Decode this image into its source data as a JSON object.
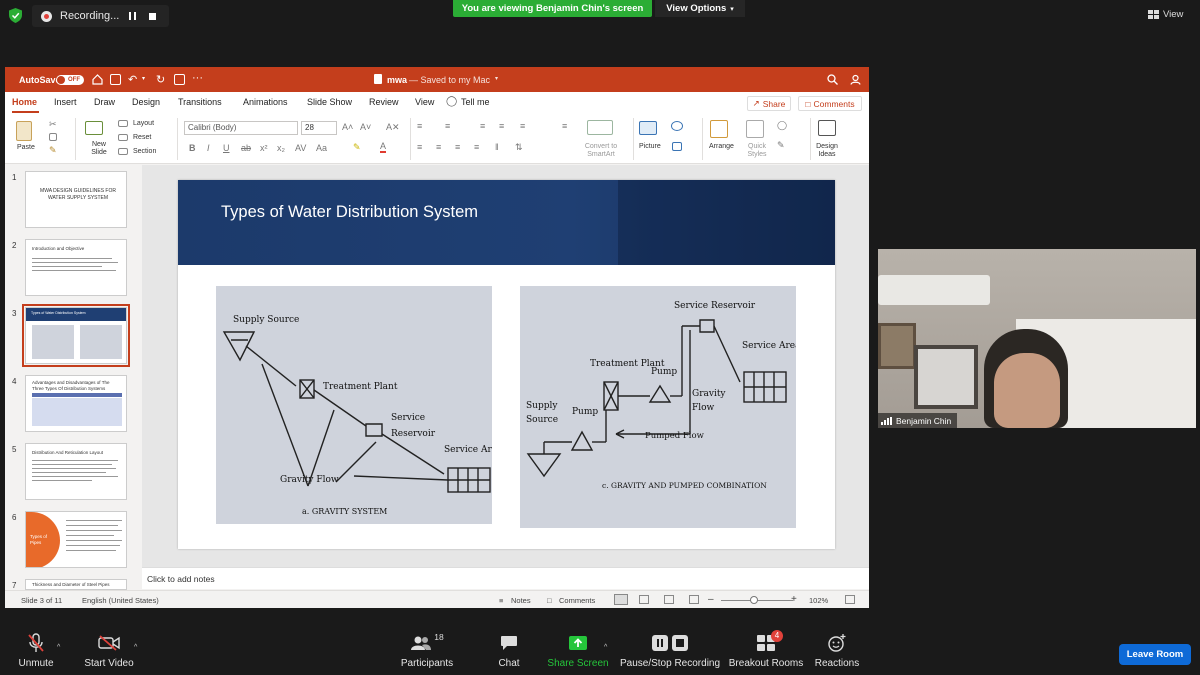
{
  "zoom": {
    "recording_label": "Recording...",
    "viewing_banner": "You are viewing Benjamin Chin's screen",
    "view_options": "View Options",
    "view_label": "View",
    "toolbar": {
      "unmute": "Unmute",
      "start_video": "Start Video",
      "participants": "Participants",
      "participants_count": "18",
      "chat": "Chat",
      "share_screen": "Share Screen",
      "pause_stop_recording": "Pause/Stop Recording",
      "breakout_rooms": "Breakout Rooms",
      "breakout_badge": "4",
      "reactions": "Reactions",
      "leave_room": "Leave Room"
    },
    "video": {
      "participant_name": "Benjamin Chin"
    }
  },
  "ppt": {
    "autosave": "AutoSave",
    "autosave_state": "OFF",
    "doc_title": "mwa",
    "doc_status": "— Saved to my Mac",
    "tabs": [
      "Home",
      "Insert",
      "Draw",
      "Design",
      "Transitions",
      "Animations",
      "Slide Show",
      "Review",
      "View"
    ],
    "tell_me": "Tell me",
    "share": "Share",
    "comments": "Comments",
    "ribbon": {
      "paste": "Paste",
      "new_slide": "New Slide",
      "layout": "Layout",
      "reset": "Reset",
      "section": "Section",
      "font": "Calibri (Body)",
      "font_size": "28",
      "convert_smartart": "Convert to SmartArt",
      "picture": "Picture",
      "arrange": "Arrange",
      "quick_styles": "Quick Styles",
      "design_ideas": "Design Ideas"
    },
    "thumbnails": [
      {
        "num": "1",
        "title": "MWA DESIGN GUIDELINES FOR WATER SUPPLY SYSTEM"
      },
      {
        "num": "2",
        "title": "Introduction and Objective"
      },
      {
        "num": "3",
        "title": "Types of Water Distribution System"
      },
      {
        "num": "4",
        "title": "Advantages and Disadvantages of The Three Types Of Distribution Systems"
      },
      {
        "num": "5",
        "title": "Distribution And Reticulation Layout"
      },
      {
        "num": "6",
        "title": "Types of Pipes"
      },
      {
        "num": "7",
        "title": "Thickness and Diameter of Steel Pipes"
      }
    ],
    "slide": {
      "title": "Types of Water Distribution System",
      "fig_a": {
        "supply_source": "Supply Source",
        "treatment_plant": "Treatment Plant",
        "service": "Service",
        "reservoir": "Reservoir",
        "service_area": "Service Area",
        "gravity_flow": "Gravity Flow",
        "caption": "a. GRAVITY SYSTEM"
      },
      "fig_c": {
        "service_reservoir": "Service Reservoir",
        "service_area": "Service Area",
        "treatment_plant": "Treatment Plant",
        "pump_top": "Pump",
        "gravity": "Gravity",
        "flow": "Flow",
        "supply": "Supply",
        "source": "Source",
        "pump_left": "Pump",
        "pumped_flow": "Pumped Flow",
        "caption": "c. GRAVITY AND PUMPED COMBINATION"
      }
    },
    "notes_placeholder": "Click to add notes",
    "status": {
      "slide_of": "Slide 3 of 11",
      "language": "English (United States)",
      "notes": "Notes",
      "comments": "Comments",
      "zoom": "102%"
    }
  }
}
